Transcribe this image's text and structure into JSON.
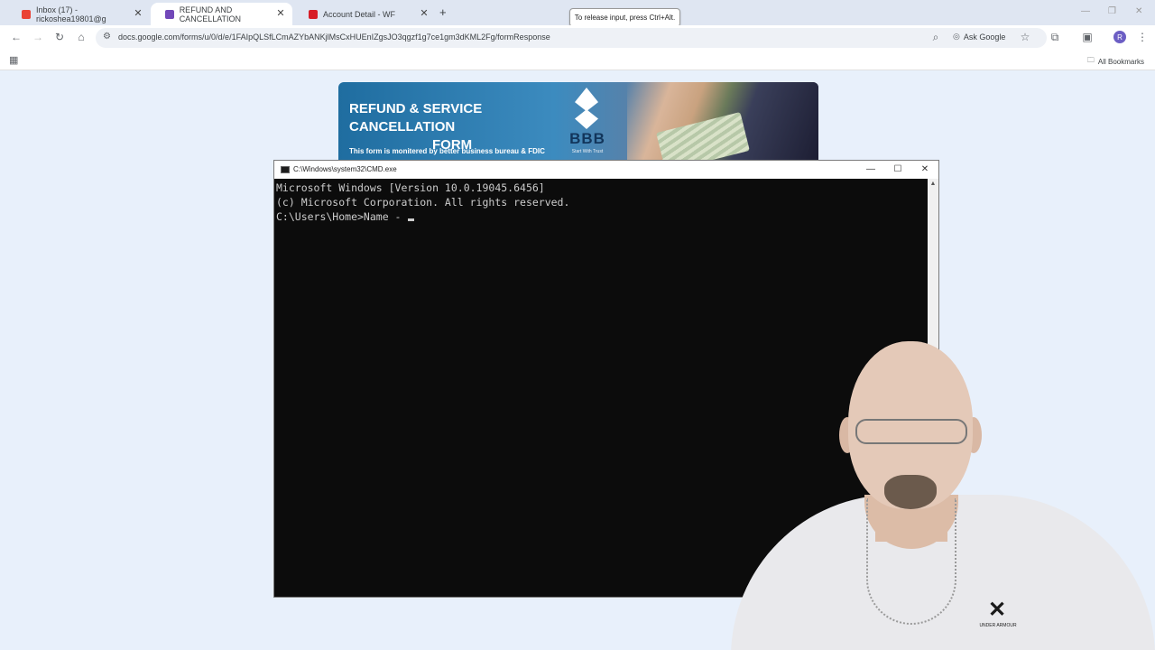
{
  "browser": {
    "tabs": [
      {
        "label": "Inbox (17) - rickoshea19801@g",
        "icon": "gmail-icon",
        "color": "#ea4335"
      },
      {
        "label": "REFUND AND CANCELLATION",
        "icon": "google-forms-icon",
        "color": "#7248b9"
      },
      {
        "label": "Account Detail - WF",
        "icon": "wells-fargo-icon",
        "color": "#d71e28"
      }
    ],
    "active_tab": 1,
    "new_tab": "+",
    "tooltip": "To release input, press Ctrl+Alt.",
    "url": "docs.google.com/forms/u/0/d/e/1FAIpQLSfLCmAZYbANKjlMsCxHUEnIZgsJO3qgzf1g7ce1gm3dKML2Fg/formResponse",
    "ask_google": "Ask Google",
    "avatar_letter": "R",
    "all_bookmarks": "All Bookmarks"
  },
  "banner": {
    "title_line1": "REFUND & SERVICE CANCELLATION",
    "title_line2": "FORM",
    "subtitle": "This form is monitered by better business bureau & FDIC",
    "bbb_logo": "BBB",
    "bbb_tagline": "Start With Trust"
  },
  "cmd": {
    "title": "C:\\Windows\\system32\\CMD.exe",
    "lines": [
      "Microsoft Windows [Version 10.0.19045.6456]",
      "(c) Microsoft Corporation. All rights reserved.",
      "",
      "C:\\Users\\Home>Name - "
    ]
  },
  "webcam": {
    "shirt_brand": "UNDER ARMOUR"
  },
  "colors": {
    "page_bg": "#e8f0fb",
    "cmd_bg": "#0c0c0c",
    "cmd_text": "#cccccc",
    "banner_blue": "#1f6da0"
  }
}
